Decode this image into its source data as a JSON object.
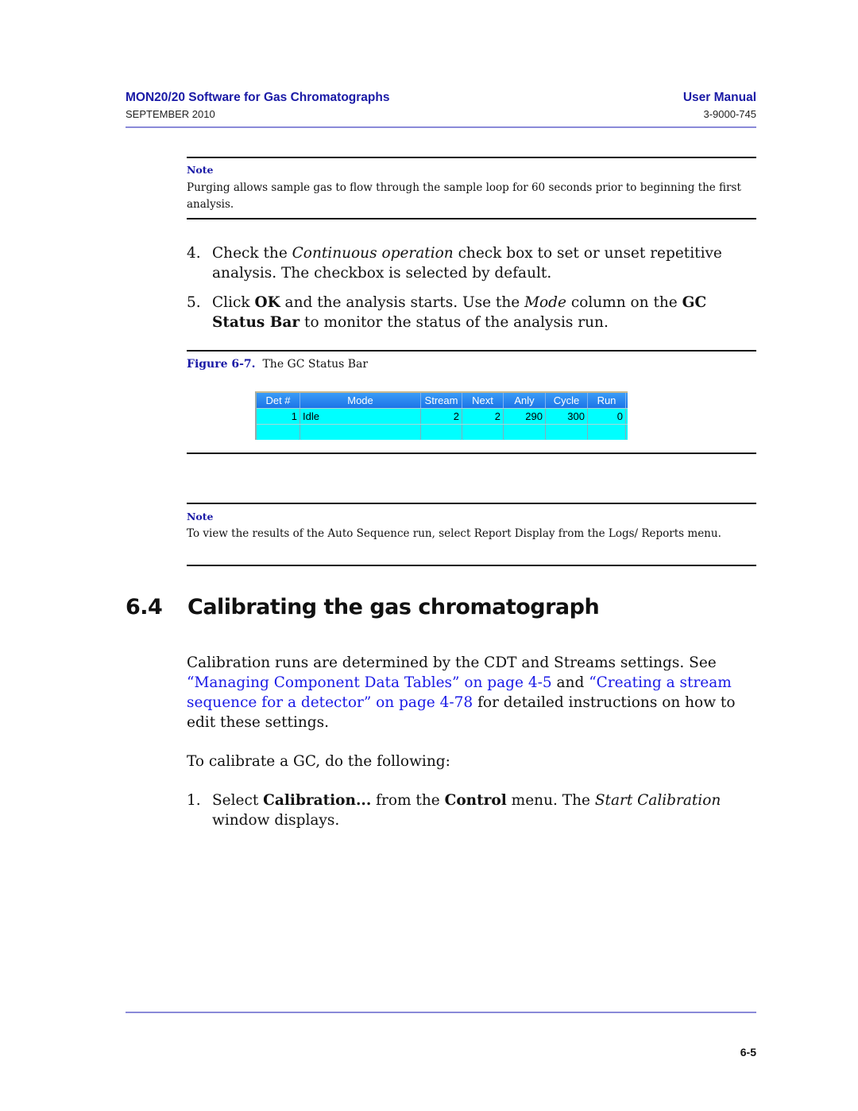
{
  "header": {
    "title": "MON20/20 Software for Gas Chromatographs",
    "doc_type": "User Manual",
    "date": "SEPTEMBER 2010",
    "doc_number": "3-9000-745"
  },
  "note1": {
    "label": "Note",
    "text": "Purging allows sample gas to flow through the sample loop for 60 seconds prior to beginning the first analysis."
  },
  "steps_a": [
    {
      "num": "4.",
      "parts": [
        "Check the ",
        "Continuous operation",
        " check box to set or unset repetitive analysis. The checkbox is selected by default."
      ]
    },
    {
      "num": "5.",
      "parts": [
        "Click ",
        "OK",
        " and the analysis starts.  Use the ",
        "Mode",
        " column on the ",
        "GC Status Bar",
        " to monitor the status of the analysis run."
      ]
    }
  ],
  "figure": {
    "label": "Figure 6-7.",
    "caption": "The GC Status Bar"
  },
  "gc_status_bar": {
    "columns": [
      "Det #",
      "Mode",
      "Stream",
      "Next",
      "Anly",
      "Cycle",
      "Run"
    ],
    "rows": [
      [
        "1",
        "Idle",
        "2",
        "2",
        "290",
        "300",
        "0"
      ],
      [
        "",
        "",
        "",
        "",
        "",
        "",
        ""
      ]
    ],
    "colors": {
      "header": "#1c74e8",
      "row": "#00ffff"
    }
  },
  "note2": {
    "label": "Note",
    "text": "To view the results of the Auto Sequence run, select Report Display from the Logs/ Reports menu."
  },
  "section": {
    "number": "6.4",
    "title": "Calibrating the gas chromatograph"
  },
  "intro": {
    "text1": "Calibration runs are determined by the CDT and Streams settings. See ",
    "link1": "“Managing Component Data Tables” on page 4-5",
    "text2": " and ",
    "link2": "“Creating a stream sequence for a detector” on page 4-78",
    "text3": " for detailed instructions on how to edit these settings."
  },
  "lead": "To calibrate a GC, do the following:",
  "steps_b": [
    {
      "num": "1.",
      "parts": [
        "Select ",
        "Calibration...",
        " from the ",
        "Control",
        " menu.  The ",
        "Start Calibration",
        " window displays."
      ]
    }
  ],
  "footer": {
    "page_number": "6-5"
  }
}
